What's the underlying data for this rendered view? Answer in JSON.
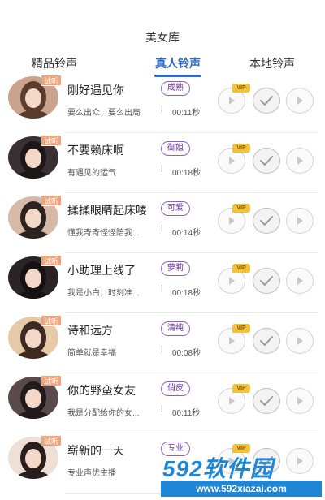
{
  "header": {
    "title": "美女库"
  },
  "tabs": [
    {
      "label": "精品铃声"
    },
    {
      "label": "真人铃声"
    },
    {
      "label": "本地铃声"
    }
  ],
  "trial_label": "试听",
  "vip_label": "VIP",
  "separator": "|",
  "items": [
    {
      "name": "刚好遇见你",
      "desc": "要么出众，要么出局",
      "tag": "成熟",
      "duration": "00:11秒"
    },
    {
      "name": "不要赖床啊",
      "desc": "有遇见的运气",
      "tag": "御姐",
      "duration": "00:18秒"
    },
    {
      "name": "揉揉眼睛起床喽",
      "desc": "懂我奇奇怪怪陪我...",
      "tag": "可爱",
      "duration": "00:14秒"
    },
    {
      "name": "小助理上线了",
      "desc": "我是小白，时刻准...",
      "tag": "萝莉",
      "duration": "00:18秒"
    },
    {
      "name": "诗和远方",
      "desc": "简单就是幸福",
      "tag": "清纯",
      "duration": "00:08秒"
    },
    {
      "name": "你的野蛮女友",
      "desc": "我是分配给你的女...",
      "tag": "俏皮",
      "duration": "00:11秒"
    },
    {
      "name": "崭新的一天",
      "desc": "专业声优主播",
      "tag": "专业",
      "duration": ""
    }
  ],
  "watermark": {
    "brand": "592软件园",
    "url": "www.592xiazai.com"
  },
  "colors": {
    "accent": "#2d67c7",
    "tag_border": "#9b59d0",
    "trial": "#f4a27a",
    "vip": "#f3c23c",
    "watermark": "#1f86d6"
  }
}
